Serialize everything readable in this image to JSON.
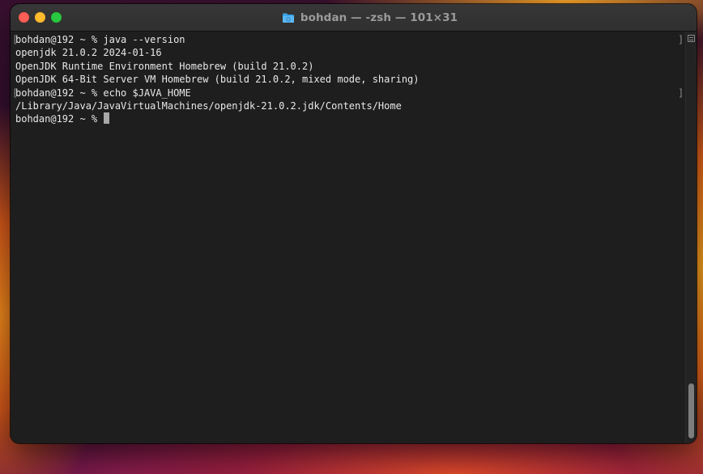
{
  "window": {
    "title": "bohdan — -zsh — 101×31",
    "title_icon": "folder-icon",
    "traffic_lights": {
      "close": "#ff5f57",
      "minimize": "#febc2e",
      "zoom": "#28c840"
    }
  },
  "terminal": {
    "lines": [
      {
        "text": "bohdan@192 ~ % java --version",
        "left_mark": "[",
        "right_mark": "]"
      },
      {
        "text": "openjdk 21.0.2 2024-01-16"
      },
      {
        "text": "OpenJDK Runtime Environment Homebrew (build 21.0.2)"
      },
      {
        "text": "OpenJDK 64-Bit Server VM Homebrew (build 21.0.2, mixed mode, sharing)"
      },
      {
        "text": "bohdan@192 ~ % echo $JAVA_HOME",
        "left_mark": "[",
        "right_mark": "]"
      },
      {
        "text": "/Library/Java/JavaVirtualMachines/openjdk-21.0.2.jdk/Contents/Home"
      },
      {
        "text": "bohdan@192 ~ % "
      }
    ]
  },
  "colors": {
    "background": "#1e1e1e",
    "text": "#e8e8e8",
    "cursor": "#a9a9a9"
  }
}
